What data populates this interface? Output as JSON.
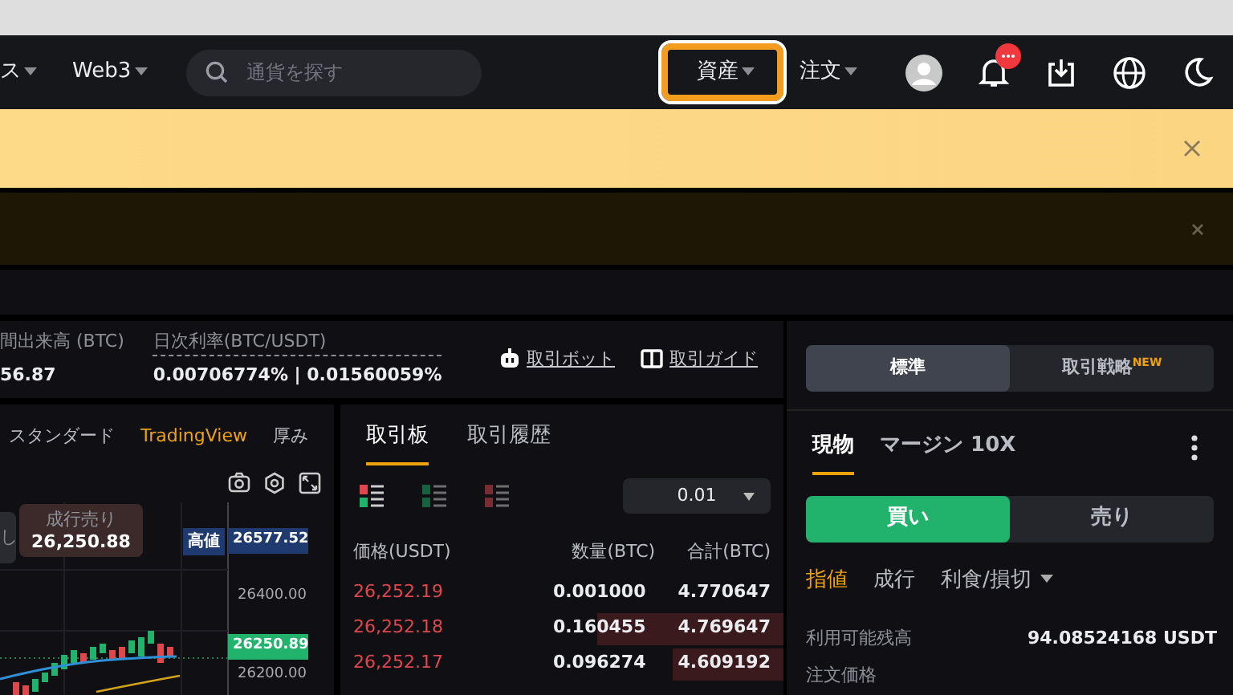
{
  "nav": {
    "left_items": [
      {
        "label": "ス"
      },
      {
        "label": "Web3"
      }
    ],
    "search": {
      "placeholder": "通貨を探す"
    },
    "right_items": [
      {
        "label": "資産",
        "highlighted": true
      },
      {
        "label": "注文",
        "highlighted": false
      }
    ]
  },
  "banners": [
    {
      "kind": "promo"
    },
    {
      "kind": "notice"
    }
  ],
  "ticker": {
    "stats": [
      {
        "label": "間出来高 (BTC)",
        "value": "56.87",
        "dotted": false
      },
      {
        "label": "日次利率(BTC/USDT)",
        "value": "0.00706774% | 0.01560059%",
        "dotted": true
      }
    ],
    "links": [
      {
        "kind": "bot",
        "label": "取引ボット"
      },
      {
        "kind": "guide",
        "label": "取引ガイド"
      }
    ]
  },
  "chart": {
    "tabs": [
      {
        "label": "スタンダード",
        "selected": false
      },
      {
        "label": "TradingView",
        "selected": true
      },
      {
        "label": "厚み",
        "selected": false
      }
    ],
    "partial_button": "し",
    "sell_button": {
      "label": "成行売り",
      "price": "26,250.88"
    },
    "high": {
      "label": "高値",
      "value": "26577.52"
    },
    "axis_labels": [
      "26400.00",
      "26200.00"
    ],
    "last_price": "26250.89"
  },
  "orderbook": {
    "tabs": [
      {
        "label": "取引板",
        "selected": true
      },
      {
        "label": "取引履歴",
        "selected": false
      }
    ],
    "views": [
      {
        "kind": "both",
        "selected": true
      },
      {
        "kind": "bids",
        "selected": false
      },
      {
        "kind": "asks",
        "selected": false
      }
    ],
    "tick": "0.01",
    "columns": [
      "価格(USDT)",
      "数量(BTC)",
      "合計(BTC)"
    ],
    "rows": [
      {
        "price": "26,252.19",
        "amount": "0.001000",
        "total": "4.770647"
      },
      {
        "price": "26,252.18",
        "amount": "0.160455",
        "total": "4.769647",
        "level": 0.42
      },
      {
        "price": "26,252.17",
        "amount": "0.096274",
        "total": "4.609192",
        "level": 0.25
      }
    ]
  },
  "trade": {
    "modes": [
      {
        "label": "標準",
        "selected": true
      },
      {
        "label": "取引戦略",
        "badge": "NEW",
        "selected": false
      }
    ],
    "tabs": [
      {
        "label": "現物",
        "selected": true
      },
      {
        "label": "マージン 10X",
        "selected": false
      }
    ],
    "sides": [
      {
        "label": "買い",
        "selected": true
      },
      {
        "label": "売り",
        "selected": false
      }
    ],
    "order_types": [
      {
        "label": "指値",
        "selected": true,
        "dropdown": false
      },
      {
        "label": "成行",
        "selected": false,
        "dropdown": false
      },
      {
        "label": "利食/損切",
        "selected": false,
        "dropdown": true
      }
    ],
    "balance": {
      "label": "利用可能残高",
      "value": "94.08524168 USDT"
    },
    "price_label": "注文価格"
  }
}
